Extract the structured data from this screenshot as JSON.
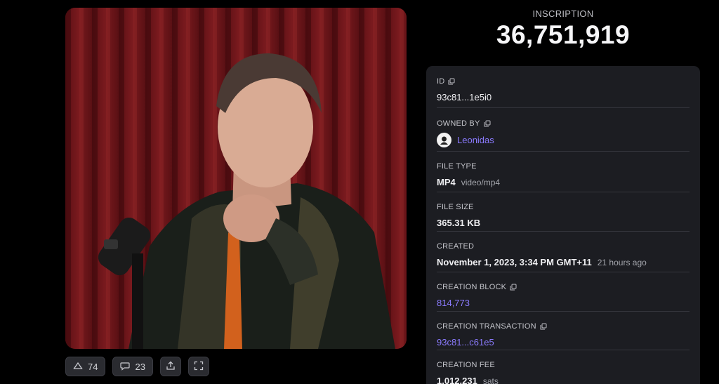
{
  "inscription": {
    "label": "INSCRIPTION",
    "number": "36,751,919"
  },
  "actions": {
    "likes": "74",
    "comments": "23"
  },
  "details": {
    "id": {
      "label": "ID",
      "value": "93c81...1e5i0"
    },
    "owner": {
      "label": "OWNED BY",
      "value": "Leonidas"
    },
    "file_type": {
      "label": "FILE TYPE",
      "value": "MP4",
      "mime": "video/mp4"
    },
    "file_size": {
      "label": "FILE SIZE",
      "value": "365.31 KB"
    },
    "created": {
      "label": "CREATED",
      "value": "November 1, 2023, 3:34 PM GMT+11",
      "relative": "21 hours ago"
    },
    "creation_block": {
      "label": "CREATION BLOCK",
      "value": "814,773"
    },
    "creation_tx": {
      "label": "CREATION TRANSACTION",
      "value": "93c81...c61e5"
    },
    "creation_fee": {
      "label": "CREATION FEE",
      "value": "1,012,231",
      "unit": "sats"
    }
  },
  "colors": {
    "accent": "#8b7bff",
    "panel": "#1c1d22",
    "background": "#000000"
  }
}
